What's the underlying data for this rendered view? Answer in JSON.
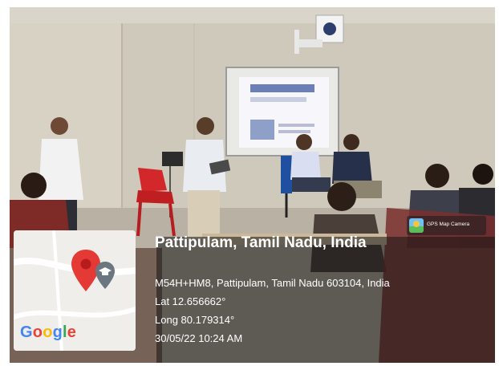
{
  "photo": {
    "description_icon": "photo"
  },
  "location": {
    "title": "Pattipulam, Tamil Nadu, India",
    "address": "M54H+HM8, Pattipulam, Tamil Nadu 603104, India",
    "latitude": "Lat 12.656662°",
    "longitude": "Long 80.179314°",
    "datetime": "30/05/22 10:24 AM"
  },
  "map": {
    "logo_text": "Google",
    "pin_icon": "map-pin-icon",
    "marker_icon": "graduation-cap-marker-icon"
  },
  "watermark": {
    "label": "GPS Map Camera",
    "icon": "gps-map-camera-icon"
  },
  "colors": {
    "pin_red": "#e53935",
    "overlay": "#141414",
    "google_blue": "#4285F4",
    "google_red": "#EA4335",
    "google_yellow": "#FBBC05",
    "google_green": "#34A853"
  }
}
